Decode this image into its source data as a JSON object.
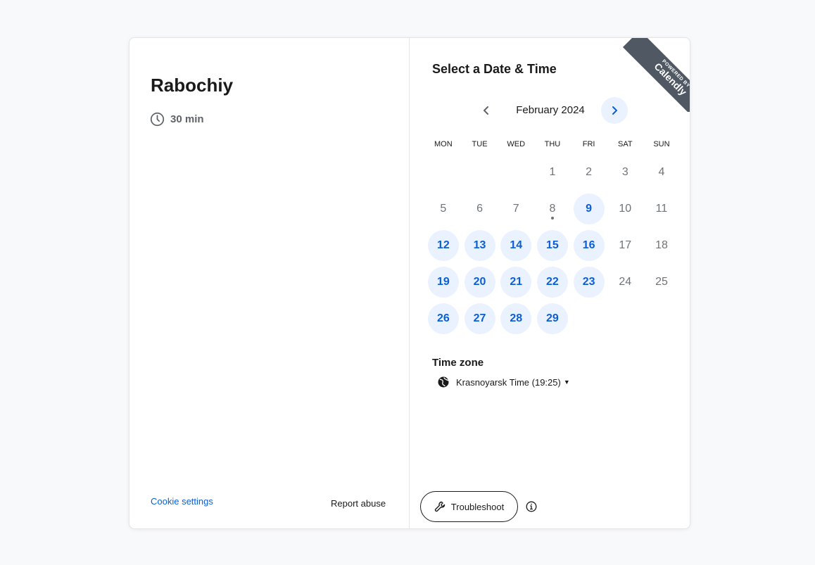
{
  "event": {
    "title": "Rabochiy",
    "duration": "30 min",
    "icon": "clock-icon"
  },
  "footer": {
    "cookie_settings": "Cookie settings",
    "report_abuse": "Report abuse"
  },
  "scheduler": {
    "title": "Select a Date & Time",
    "ribbon": {
      "small": "POWERED BY",
      "big": "Calendly"
    },
    "month": "February 2024",
    "weekdays": [
      "MON",
      "TUE",
      "WED",
      "THU",
      "FRI",
      "SAT",
      "SUN"
    ],
    "days": [
      {
        "label": "",
        "available": false
      },
      {
        "label": "",
        "available": false
      },
      {
        "label": "",
        "available": false
      },
      {
        "label": "1",
        "available": false
      },
      {
        "label": "2",
        "available": false
      },
      {
        "label": "3",
        "available": false
      },
      {
        "label": "4",
        "available": false
      },
      {
        "label": "5",
        "available": false
      },
      {
        "label": "6",
        "available": false
      },
      {
        "label": "7",
        "available": false
      },
      {
        "label": "8",
        "available": false,
        "today": true
      },
      {
        "label": "9",
        "available": true
      },
      {
        "label": "10",
        "available": false
      },
      {
        "label": "11",
        "available": false
      },
      {
        "label": "12",
        "available": true
      },
      {
        "label": "13",
        "available": true
      },
      {
        "label": "14",
        "available": true
      },
      {
        "label": "15",
        "available": true
      },
      {
        "label": "16",
        "available": true
      },
      {
        "label": "17",
        "available": false
      },
      {
        "label": "18",
        "available": false
      },
      {
        "label": "19",
        "available": true
      },
      {
        "label": "20",
        "available": true
      },
      {
        "label": "21",
        "available": true
      },
      {
        "label": "22",
        "available": true
      },
      {
        "label": "23",
        "available": true
      },
      {
        "label": "24",
        "available": false
      },
      {
        "label": "25",
        "available": false
      },
      {
        "label": "26",
        "available": true
      },
      {
        "label": "27",
        "available": true
      },
      {
        "label": "28",
        "available": true
      },
      {
        "label": "29",
        "available": true
      }
    ],
    "timezone_label": "Time zone",
    "timezone_value": "Krasnoyarsk Time (19:25)",
    "troubleshoot": "Troubleshoot"
  },
  "colors": {
    "accent": "#0b5fd6",
    "available_bg": "#eaf2ff",
    "ribbon": "#505863"
  }
}
